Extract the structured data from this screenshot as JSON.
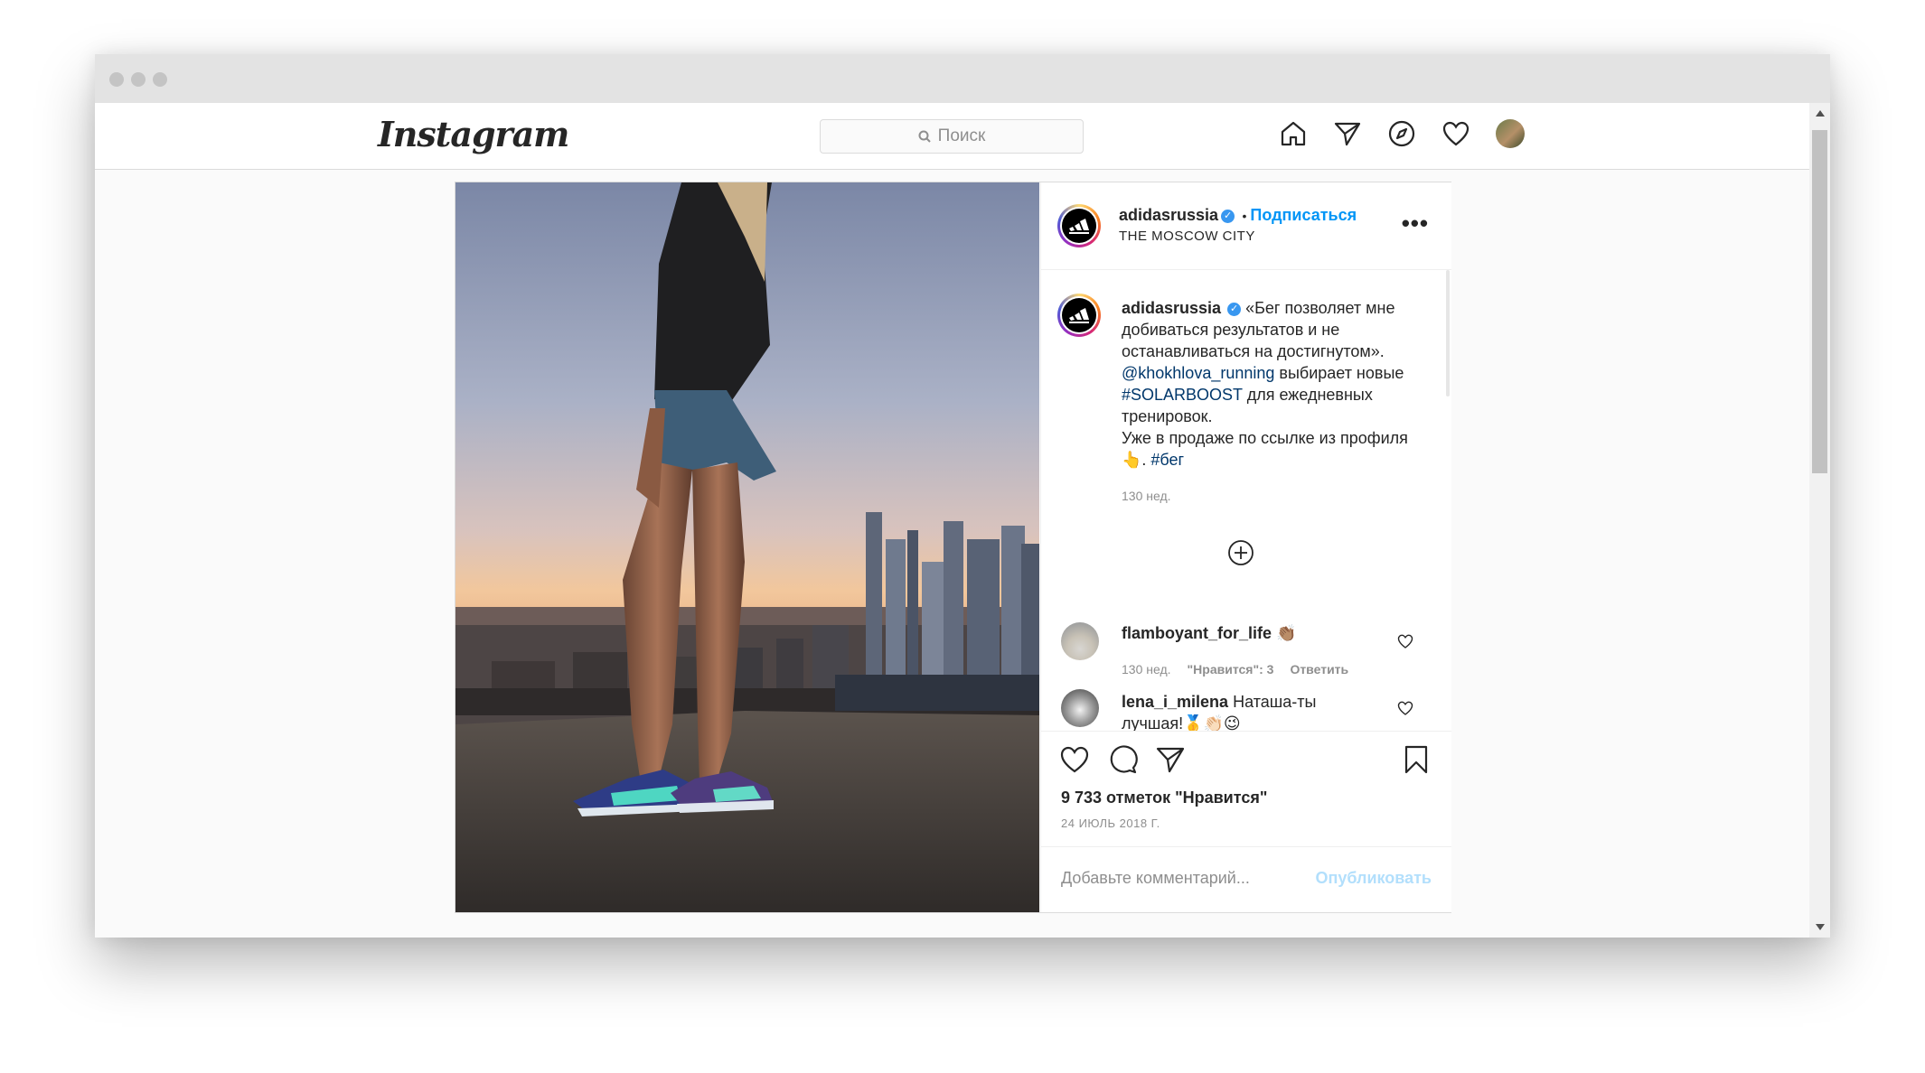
{
  "nav": {
    "logo": "Instagram",
    "search_placeholder": "Поиск",
    "icons": [
      "home-icon",
      "direct-icon",
      "explore-icon",
      "activity-heart-icon",
      "profile-avatar"
    ]
  },
  "post": {
    "username": "adidasrussia",
    "follow_separator": "•",
    "follow_label": "Подписаться",
    "location": "THE MOSCOW CITY",
    "more": "•••",
    "caption": {
      "username": "adidasrussia",
      "text1": "«Бег позволяет мне добиваться результатов и не останавливаться на достигнутом».",
      "mention": "@khokhlova_running",
      "text2": " выбирает новые ",
      "hashtag1": "#SOLARBOOST",
      "text3": " для ежедневных тренировок.",
      "text4": "Уже в продаже по ссылке из профиля 👆. ",
      "hashtag2": "#бег",
      "time": "130 нед."
    },
    "comments": [
      {
        "username": "flamboyant_for_life",
        "text": "👏🏽",
        "time": "130 нед.",
        "likes": "\"Нравится\": 3",
        "reply": "Ответить"
      },
      {
        "username": "lena_i_milena",
        "text": "Наташа-ты лучшая!🥇👏🏻😉"
      }
    ],
    "likes_count": "9 733 отметок \"Нравится\"",
    "date": "24 ИЮЛЬ 2018 Г.",
    "comment_placeholder": "Добавьте комментарий...",
    "publish_label": "Опубликовать"
  },
  "colors": {
    "link": "#00376b",
    "follow": "#0095f6",
    "publish_disabled": "#b2dffc",
    "verified": "#3897f0"
  }
}
